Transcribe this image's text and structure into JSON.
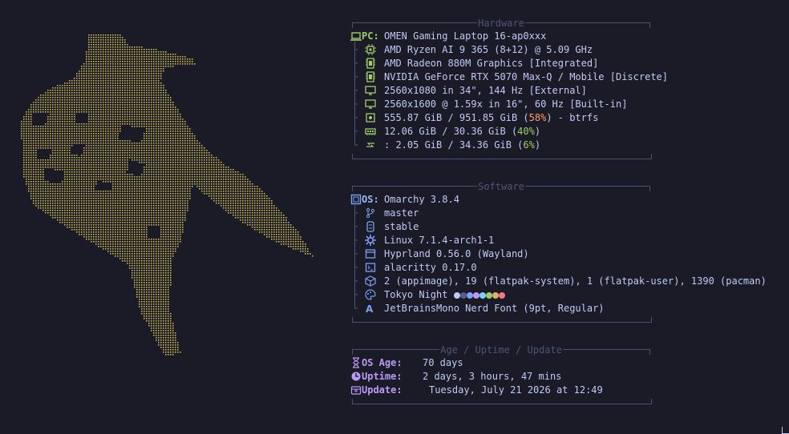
{
  "colors": {
    "background": "#1a1b26",
    "art": "#c9b453",
    "border": "#4a5070",
    "label_blue": "#7aa2f7",
    "label_purple": "#bb9af7",
    "text": "#c0caf5",
    "orange": "#ff9e64",
    "green": "#9ece6a"
  },
  "hardware": {
    "title": "Hardware",
    "pc_label": "PC",
    "pc_value": "OMEN Gaming Laptop 16-ap0xxx",
    "items": [
      {
        "icon": "cpu-icon",
        "value": "AMD Ryzen AI 9 365 (8+12) @ 5.09 GHz"
      },
      {
        "icon": "gpu-icon",
        "value": "AMD Radeon 880M Graphics [Integrated]"
      },
      {
        "icon": "gpu-icon",
        "value": "NVIDIA GeForce RTX 5070 Max-Q / Mobile [Discrete]"
      },
      {
        "icon": "monitor-icon",
        "value": "2560x1080 in 34\", 144 Hz [External]"
      },
      {
        "icon": "monitor-icon",
        "value": "2560x1600 @ 1.59x in 16\", 60 Hz [Built-in]"
      },
      {
        "icon": "disk-icon",
        "pre": "555.87 GiB / 951.85 GiB (",
        "pct": "58%",
        "post": ") - btrfs"
      },
      {
        "icon": "memory-icon",
        "pre": "12.06 GiB / 30.36 GiB (",
        "pct": "40%",
        "post": ")"
      },
      {
        "icon": "swap-icon",
        "pre": ": 2.05 GiB / 34.36 GiB (",
        "pct": "6%",
        "post": ")"
      }
    ]
  },
  "software": {
    "title": "Software",
    "os_label": "OS",
    "os_value": "Omarchy 3.8.4",
    "items": [
      {
        "icon": "git-branch-icon",
        "value": "master"
      },
      {
        "icon": "channel-icon",
        "value": "stable"
      },
      {
        "icon": "kernel-gear-icon",
        "value": "Linux 7.1.4-arch1-1"
      },
      {
        "icon": "window-manager-icon",
        "value": "Hyprland 0.56.0 (Wayland)"
      },
      {
        "icon": "terminal-icon",
        "value": "alacritty 0.17.0"
      },
      {
        "icon": "packages-icon",
        "value": "2 (appimage), 19 (flatpak-system), 1 (flatpak-user), 1390 (pacman)"
      },
      {
        "icon": "palette-icon",
        "value": "Tokyo Night ",
        "swatches": [
          "#c0caf5",
          "#565f89",
          "#7aa2f7",
          "#bb9af7",
          "#7dcfff",
          "#9ece6a",
          "#e0af68",
          "#f7768e"
        ]
      },
      {
        "icon": "font-icon",
        "value": "JetBrainsMono Nerd Font (9pt, Regular)"
      }
    ]
  },
  "uptime": {
    "title": "Age / Uptime / Update",
    "items": [
      {
        "icon": "hourglass-icon",
        "label": "OS Age",
        "value": "70 days"
      },
      {
        "icon": "clock-icon",
        "label": "Uptime",
        "value": "2 days, 3 hours, 47 mins"
      },
      {
        "icon": "box-icon",
        "label": "Update",
        "value": "Tuesday, July 21 2026 at 12:49"
      }
    ]
  }
}
